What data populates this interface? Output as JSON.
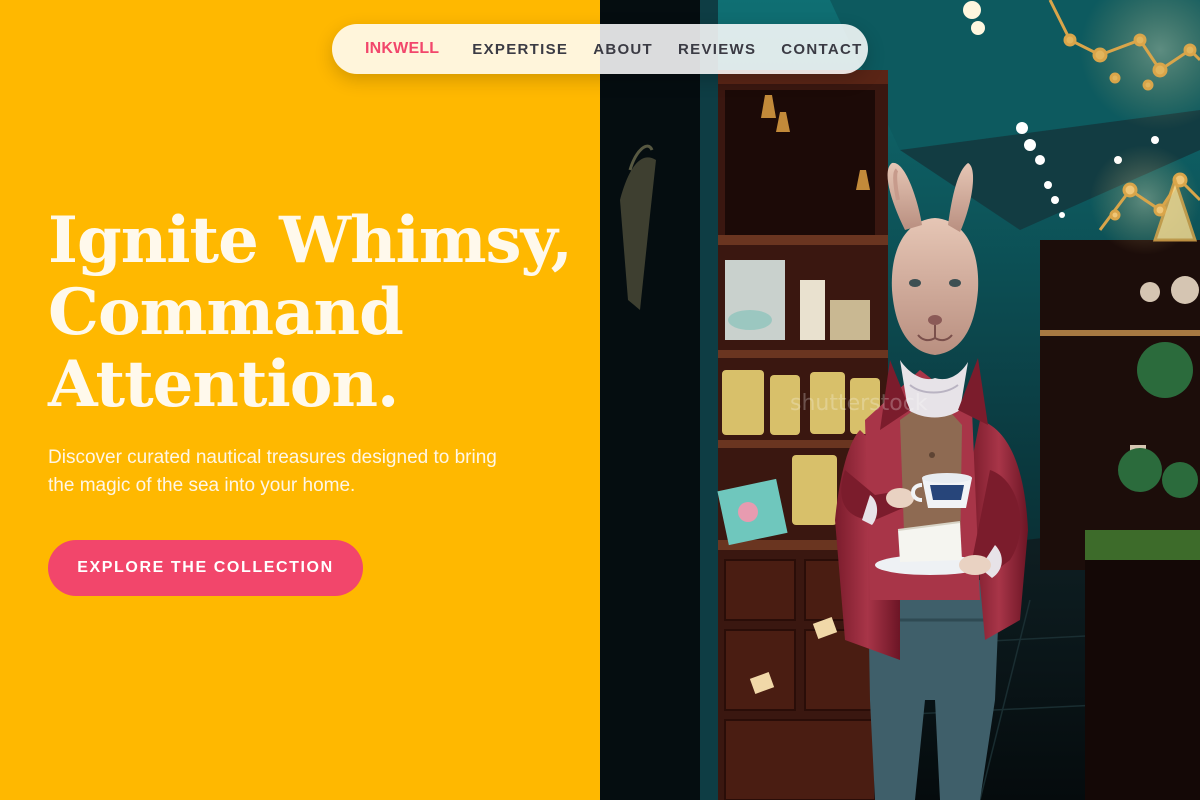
{
  "nav": {
    "brand": "INKWELL",
    "links": [
      "EXPERTISE",
      "ABOUT",
      "REVIEWS",
      "CONTACT"
    ]
  },
  "hero": {
    "title_lines": [
      "Ignite Whimsy,",
      "Command",
      "Attention."
    ],
    "subtitle": "Discover curated nautical treasures designed to bring the magic of the sea into your home.",
    "cta_label": "EXPLORE THE COLLECTION"
  },
  "photo": {
    "subject": "rabbit-figure-in-red-coat-holding-teacup-in-tea-shop"
  },
  "colors": {
    "left_background": "#FFB800",
    "accent": "#F2466B",
    "title_text": "#FFF9EC",
    "nav_text": "#3b3b44"
  }
}
